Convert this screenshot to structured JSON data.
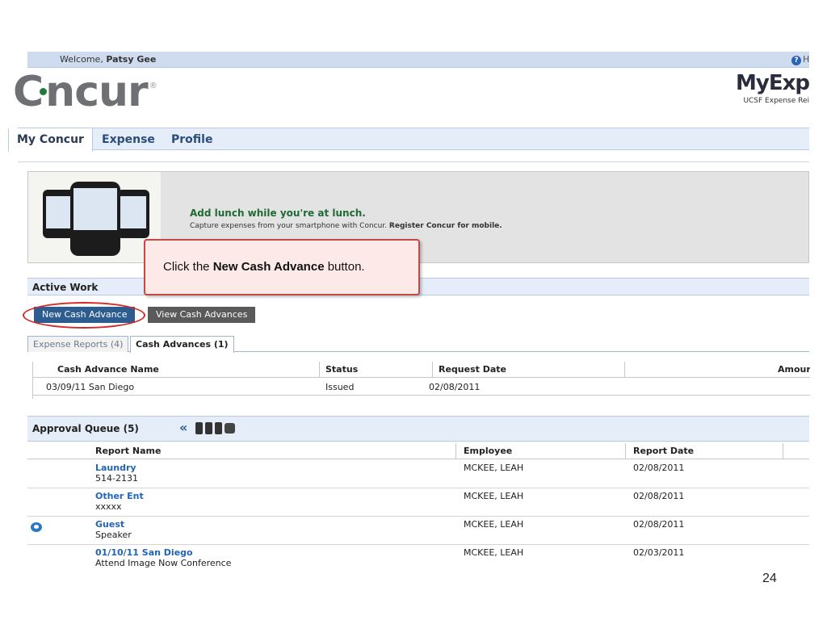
{
  "header": {
    "welcome_prefix": "Welcome,",
    "username": "Patsy Gee",
    "help_label": "H",
    "logo_c": "C",
    "logo_rest": "ncur",
    "logo_reg": "®",
    "brand_title": "MyExp",
    "brand_subtitle": "UCSF Expense Rei"
  },
  "nav": {
    "tabs": [
      "My Concur",
      "Expense",
      "Profile"
    ]
  },
  "banner": {
    "title": "Add lunch while you're at lunch.",
    "subtitle": "Capture expenses from your smartphone with Concur.",
    "subtitle_link": "Register Concur for mobile."
  },
  "callout": {
    "prefix": "Click the",
    "bold": "New Cash Advance",
    "suffix": "button."
  },
  "active_work": {
    "title": "Active Work",
    "buttons": [
      "New Cash Advance",
      "View Cash Advances"
    ],
    "sub_tabs": [
      "Expense Reports (4)",
      "Cash Advances (1)"
    ],
    "columns": [
      "Cash Advance Name",
      "Status",
      "Request Date",
      "Amour"
    ],
    "rows": [
      {
        "name": "03/09/11 San Diego",
        "status": "Issued",
        "request_date": "02/08/2011"
      }
    ]
  },
  "approval_queue": {
    "title": "Approval Queue (5)",
    "chevron": "«",
    "columns": [
      "Report Name",
      "Employee",
      "Report Date"
    ],
    "rows": [
      {
        "name": "Laundry",
        "purpose": "514-2131",
        "employee": "MCKEE, LEAH",
        "date": "02/08/2011"
      },
      {
        "name": "Other Ent",
        "purpose": "xxxxx",
        "employee": "MCKEE, LEAH",
        "date": "02/08/2011"
      },
      {
        "name": "Guest",
        "purpose": "Speaker",
        "employee": "MCKEE, LEAH",
        "date": "02/08/2011"
      },
      {
        "name": "01/10/11 San Diego",
        "purpose": "Attend Image Now Conference",
        "employee": "MCKEE, LEAH",
        "date": "02/03/2011"
      }
    ]
  },
  "slide": {
    "page_number": "24"
  },
  "colors": {
    "accent_blue": "#2d5d90",
    "link_blue": "#2265b5",
    "highlight_red": "#d22a2a",
    "banner_green": "#1f6b33"
  }
}
